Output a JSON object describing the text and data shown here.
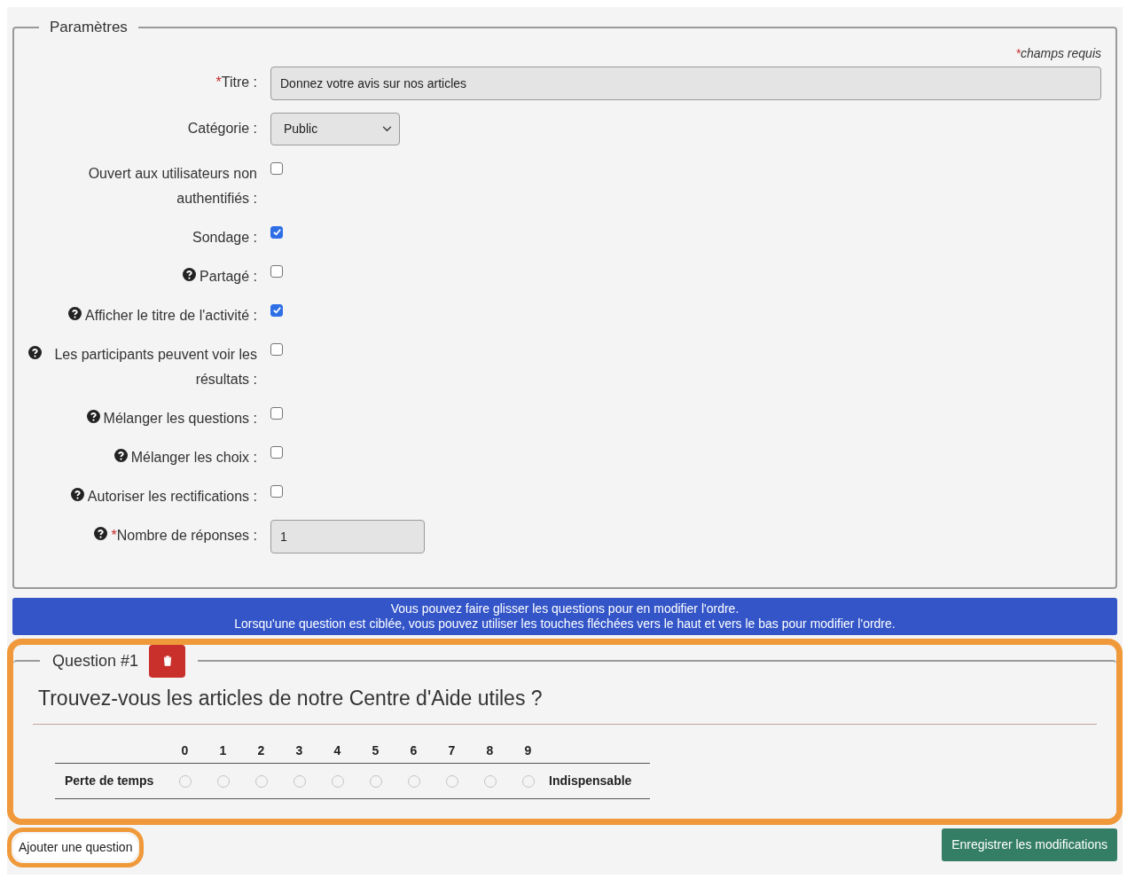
{
  "settings": {
    "legend": "Paramètres",
    "required_note": {
      "mark": "*",
      "text": "champs requis"
    },
    "fields": [
      {
        "kind": "text",
        "label": "Titre :",
        "required": true,
        "help": false,
        "value": "Donnez votre avis sur nos articles"
      },
      {
        "kind": "select",
        "label": "Catégorie :",
        "required": false,
        "help": false,
        "value": "Public"
      },
      {
        "kind": "checkbox",
        "label": "Ouvert aux utilisateurs non authentifiés :",
        "required": false,
        "help": false,
        "checked": false
      },
      {
        "kind": "checkbox",
        "label": "Sondage :",
        "required": false,
        "help": false,
        "checked": true
      },
      {
        "kind": "checkbox",
        "label": "Partagé :",
        "required": false,
        "help": true,
        "checked": false
      },
      {
        "kind": "checkbox",
        "label": "Afficher le titre de l'activité :",
        "required": false,
        "help": true,
        "checked": true
      },
      {
        "kind": "checkbox",
        "label": "Les participants peuvent voir les résultats :",
        "required": false,
        "help": true,
        "checked": false
      },
      {
        "kind": "checkbox",
        "label": "Mélanger les questions :",
        "required": false,
        "help": true,
        "checked": false
      },
      {
        "kind": "checkbox",
        "label": "Mélanger les choix :",
        "required": false,
        "help": true,
        "checked": false
      },
      {
        "kind": "checkbox",
        "label": "Autoriser les rectifications :",
        "required": false,
        "help": true,
        "checked": false
      },
      {
        "kind": "number",
        "label": "Nombre de réponses :",
        "required": true,
        "help": true,
        "value": "1"
      }
    ]
  },
  "info_banner": [
    "Vous pouvez faire glisser les questions pour en modifier l'ordre.",
    "Lorsqu'une question est ciblée, vous pouvez utiliser les touches fléchées vers le haut et vers le bas pour modifier l'ordre."
  ],
  "questions": [
    {
      "legend": "Question #1",
      "highlighted": true,
      "title": "Trouvez-vous les articles de notre Centre d'Aide utiles ?",
      "low_label": "Perte de temps",
      "high_label": "Indispensable",
      "options": [
        {
          "label": "0",
          "selected": false
        },
        {
          "label": "1",
          "selected": false
        },
        {
          "label": "2",
          "selected": false
        },
        {
          "label": "3",
          "selected": false
        },
        {
          "label": "4",
          "selected": false
        },
        {
          "label": "5",
          "selected": false
        },
        {
          "label": "6",
          "selected": false
        },
        {
          "label": "7",
          "selected": false
        },
        {
          "label": "8",
          "selected": false
        },
        {
          "label": "9",
          "selected": false
        }
      ]
    }
  ],
  "add_question": {
    "label": "Ajouter une question",
    "highlighted": true
  },
  "save_button": "Enregistrer les modifications"
}
